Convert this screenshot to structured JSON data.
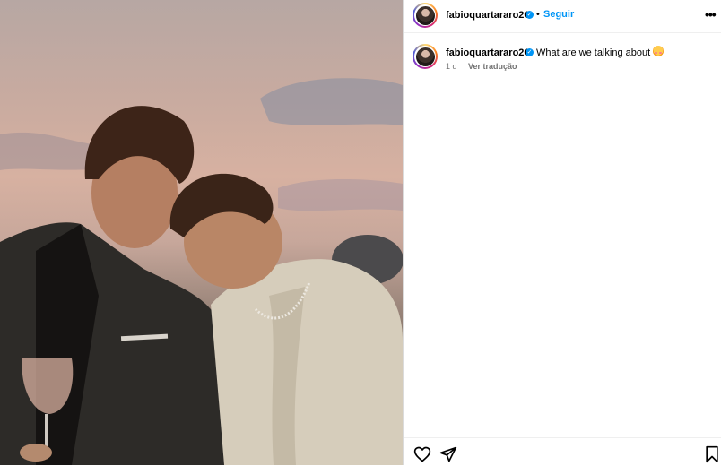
{
  "header": {
    "username": "fabioquartararo20",
    "verified_icon": "verified-badge-icon",
    "separator": "•",
    "follow_label": "Seguir",
    "more_icon": "more-options-icon"
  },
  "comment": {
    "username": "fabioquartararo20",
    "text": "What are we talking about ?",
    "emoji_icon": "smiling-face-with-hearts-emoji",
    "time": "1 d",
    "translate_label": "Ver tradução"
  },
  "actions": {
    "like_icon": "heart-icon",
    "share_icon": "send-icon",
    "save_icon": "bookmark-icon"
  },
  "photo": {
    "subject": "post-photo"
  },
  "colors": {
    "link_blue": "#0095f6",
    "muted": "#737373",
    "divider": "#efefef"
  }
}
